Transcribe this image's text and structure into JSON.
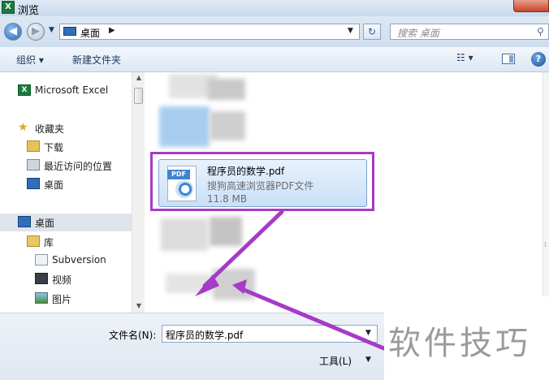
{
  "window": {
    "title": "浏览",
    "app_icon_letter": "X"
  },
  "nav": {
    "address": [
      "桌面"
    ],
    "search_placeholder": "搜索 桌面"
  },
  "toolbar": {
    "organize": "组织 ▾",
    "new_folder": "新建文件夹",
    "view": "☷ ▾"
  },
  "sidebar": {
    "items": [
      {
        "label": "Microsoft Excel",
        "icon": "excel-icon"
      },
      {
        "label": "收藏夹",
        "icon": "star-icon"
      },
      {
        "label": "下载",
        "icon": "download-folder-icon"
      },
      {
        "label": "最近访问的位置",
        "icon": "recent-places-icon"
      },
      {
        "label": "桌面",
        "icon": "desktop-icon"
      },
      {
        "label": "桌面",
        "icon": "desktop-icon",
        "selected": true
      },
      {
        "label": "库",
        "icon": "library-icon"
      },
      {
        "label": "Subversion",
        "icon": "document-icon"
      },
      {
        "label": "视频",
        "icon": "video-icon"
      },
      {
        "label": "图片",
        "icon": "picture-icon"
      }
    ]
  },
  "file": {
    "name": "程序员的数学.pdf",
    "type": "搜狗高速浏览器PDF文件",
    "size": "11.8 MB",
    "badge": "PDF"
  },
  "bottom": {
    "filename_label": "文件名(N):",
    "filename_value": "程序员的数学.pdf",
    "tools": "工具(L)"
  },
  "watermark": "软件技巧",
  "colors": {
    "highlight": "#a63bc7",
    "arrow": "#a63bc7"
  }
}
